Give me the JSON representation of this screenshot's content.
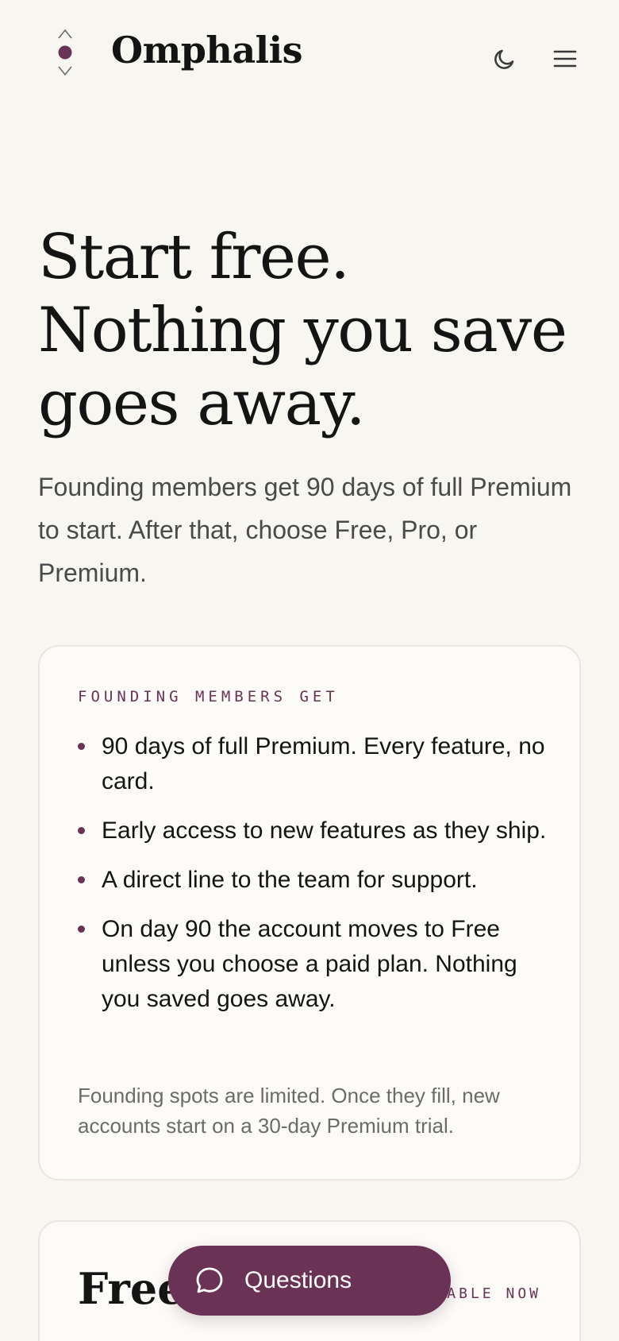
{
  "header": {
    "brand": "Omphalis",
    "icons": {
      "logo": "omphalis-logo-icon",
      "theme": "moon-icon",
      "menu": "hamburger-menu-icon"
    }
  },
  "hero": {
    "title": "Start free. Nothing you save goes away.",
    "subtitle": "Founding members get 90 days of full Premium to start. After that, choose Free, Pro, or Premium."
  },
  "founding_card": {
    "eyebrow": "FOUNDING MEMBERS GET",
    "perks": [
      "90 days of full Premium. Every feature, no card.",
      "Early access to new features as they ship.",
      "A direct line to the team for support.",
      "On day 90 the account moves to Free unless you choose a paid plan. Nothing you saved goes away."
    ],
    "note": "Founding spots are limited. Once they fill, new accounts start on a 30-day Premium trial."
  },
  "plan_card": {
    "title": "Free",
    "badge": "AVAILABLE NOW"
  },
  "questions_button": {
    "label": "Questions",
    "icon": "chat-bubble-icon"
  },
  "colors": {
    "background": "#f7f6f1",
    "accent": "#6a3356",
    "text": "#141414",
    "muted": "#4a4a4a"
  }
}
